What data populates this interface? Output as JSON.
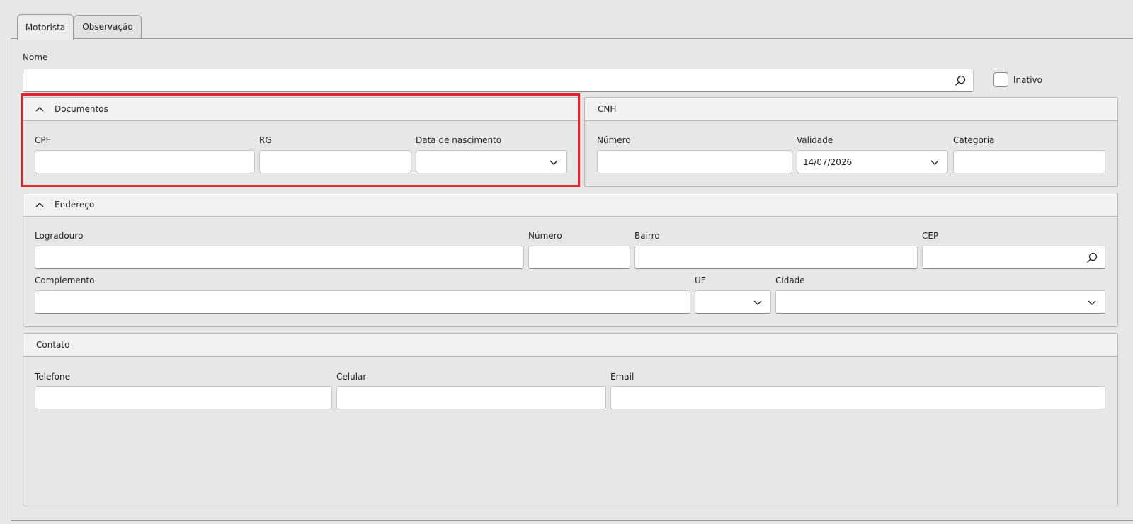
{
  "tabs": [
    {
      "label": "Motorista",
      "active": true
    },
    {
      "label": "Observação",
      "active": false
    }
  ],
  "nome": {
    "label": "Nome",
    "value": ""
  },
  "inativo": {
    "label": "Inativo",
    "checked": false
  },
  "documentos": {
    "title": "Documentos",
    "cpf": {
      "label": "CPF",
      "value": ""
    },
    "rg": {
      "label": "RG",
      "value": ""
    },
    "data_nascimento": {
      "label": "Data de nascimento",
      "value": ""
    }
  },
  "cnh": {
    "title": "CNH",
    "numero": {
      "label": "Número",
      "value": ""
    },
    "validade": {
      "label": "Validade",
      "value": "14/07/2026"
    },
    "categoria": {
      "label": "Categoria",
      "value": ""
    }
  },
  "endereco": {
    "title": "Endereço",
    "logradouro": {
      "label": "Logradouro",
      "value": ""
    },
    "numero": {
      "label": "Número",
      "value": ""
    },
    "bairro": {
      "label": "Bairro",
      "value": ""
    },
    "cep": {
      "label": "CEP",
      "value": ""
    },
    "complemento": {
      "label": "Complemento",
      "value": ""
    },
    "uf": {
      "label": "UF",
      "value": ""
    },
    "cidade": {
      "label": "Cidade",
      "value": ""
    }
  },
  "contato": {
    "title": "Contato",
    "telefone": {
      "label": "Telefone",
      "value": ""
    },
    "celular": {
      "label": "Celular",
      "value": ""
    },
    "email": {
      "label": "Email",
      "value": ""
    }
  },
  "colors": {
    "highlight": "#e0262b",
    "background": "#e7e7e7",
    "header": "#f2f2f2"
  }
}
